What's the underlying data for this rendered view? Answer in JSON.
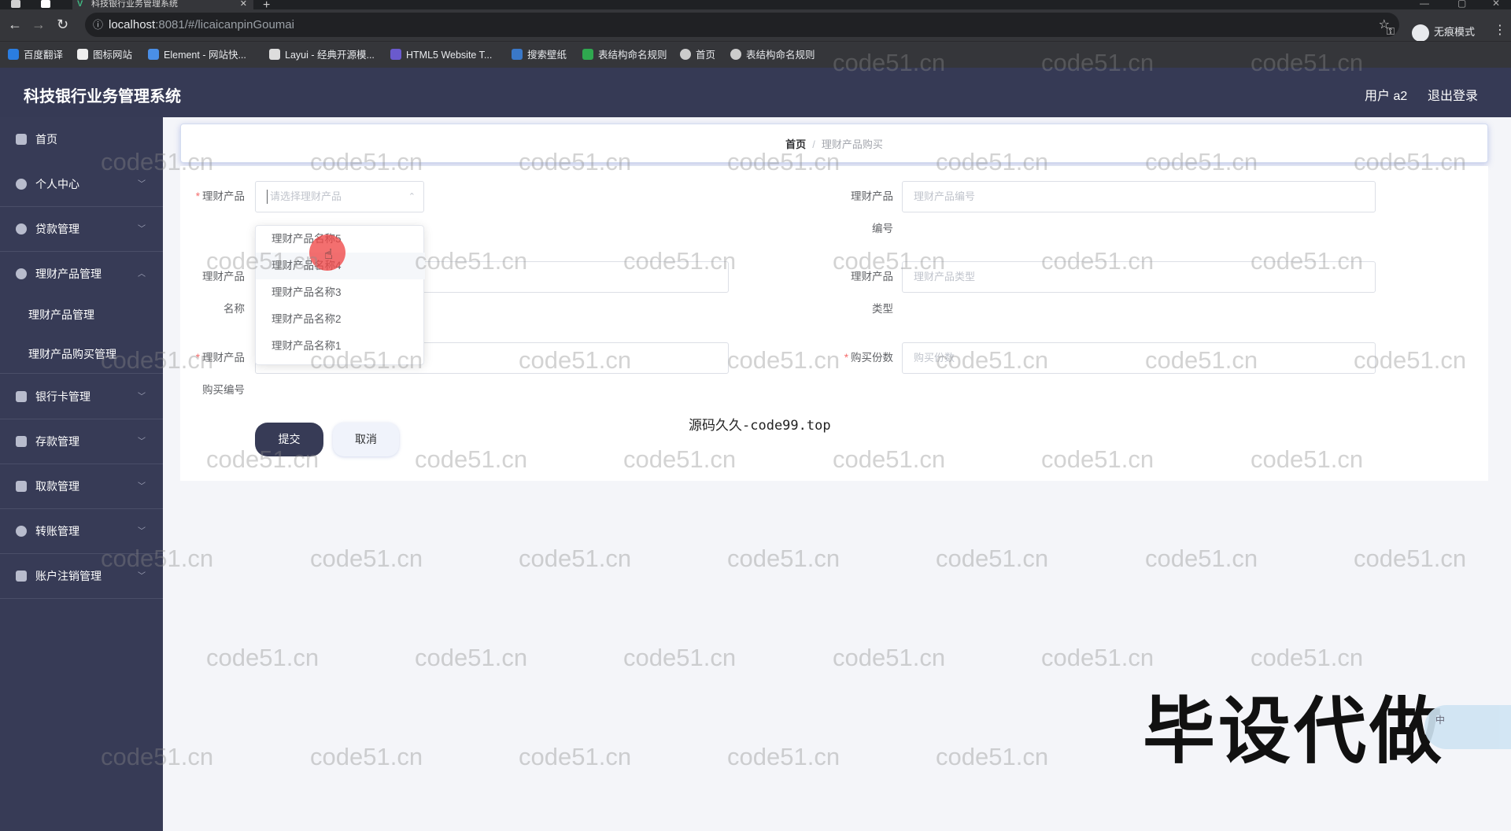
{
  "browser": {
    "tab_title": "科技银行业务管理系统",
    "url_host": "localhost",
    "url_path": ":8081/#/licaicanpinGoumai",
    "incognito_label": "无痕模式",
    "bookmarks": [
      "百度翻译",
      "图标网站",
      "Element - 网站快...",
      "Layui - 经典开源模...",
      "HTML5 Website T...",
      "搜索壁纸",
      "表结构命名规则",
      "首页",
      "表结构命名规则"
    ]
  },
  "header": {
    "title": "科技银行业务管理系统",
    "user": "用户 a2",
    "logout": "退出登录"
  },
  "sidebar": {
    "items": [
      {
        "label": "首页"
      },
      {
        "label": "个人中心"
      },
      {
        "label": "贷款管理"
      },
      {
        "label": "理财产品管理"
      },
      {
        "label": "银行卡管理"
      },
      {
        "label": "存款管理"
      },
      {
        "label": "取款管理"
      },
      {
        "label": "转账管理"
      },
      {
        "label": "账户注销管理"
      }
    ],
    "submenu": [
      "理财产品管理",
      "理财产品购买管理"
    ]
  },
  "breadcrumb": {
    "home": "首页",
    "separator": "/",
    "current": "理财产品购买"
  },
  "form": {
    "product_label": "理财产品",
    "product_placeholder": "请选择理财产品",
    "code_label_1": "理财产品",
    "code_label_2": "编号",
    "code_placeholder": "理财产品编号",
    "name_label_1": "理财产品",
    "name_label_2": "名称",
    "type_label_1": "理财产品",
    "type_label_2": "类型",
    "type_placeholder": "理财产品类型",
    "purchase_no_label_1": "理财产品",
    "purchase_no_label_2": "购买编号",
    "quantity_label": "购买份数",
    "quantity_placeholder": "购买份数",
    "submit": "提交",
    "cancel": "取消"
  },
  "dropdown": {
    "options": [
      "理财产品名称5",
      "理财产品名称4",
      "理财产品名称3",
      "理财产品名称2",
      "理财产品名称1"
    ]
  },
  "overlay": {
    "center_watermark": "源码久久-code99.top",
    "big_watermark": "毕设代做",
    "repeat_watermark": "code51.cn",
    "widget_text": "中"
  },
  "colors": {
    "sidebar": "#373b56",
    "header": "#363a55",
    "required": "#f56c6c"
  }
}
